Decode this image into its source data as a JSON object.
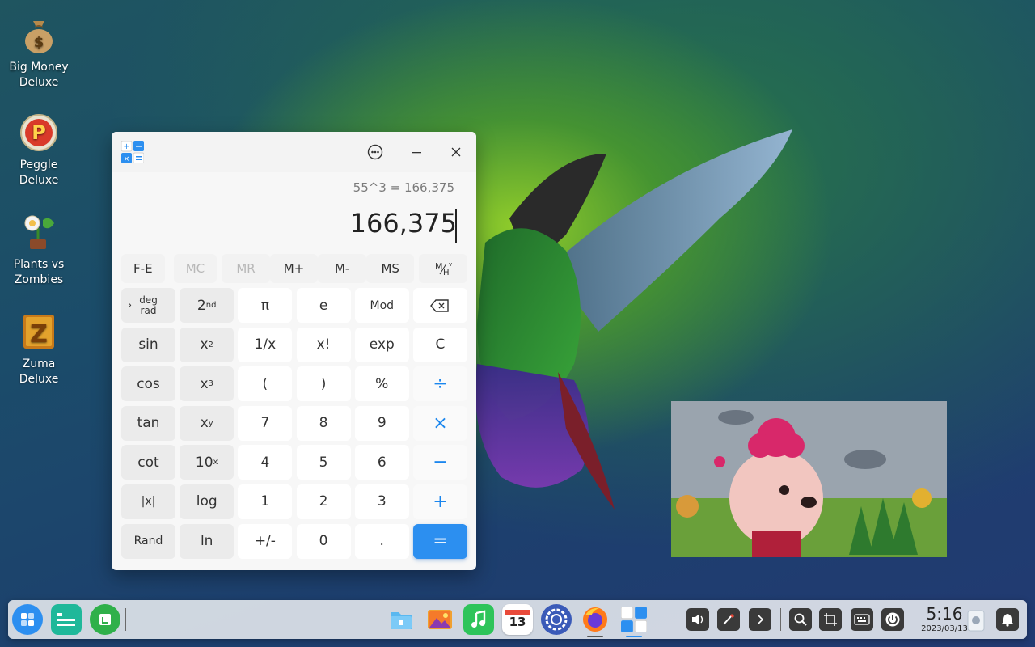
{
  "desktop": {
    "icons": [
      {
        "label": "Big Money\nDeluxe"
      },
      {
        "label": "Peggle\nDeluxe"
      },
      {
        "label": "Plants vs\nZombies"
      },
      {
        "label": "Zuma\nDeluxe"
      }
    ]
  },
  "calculator": {
    "expression": "55^3 = 166,375",
    "result": "166,375",
    "memory": [
      "F-E",
      "MC",
      "MR",
      "M+",
      "M-",
      "MS"
    ],
    "keys": {
      "deg": "deg",
      "rad": "rad",
      "second": "2",
      "second_sup": "nd",
      "pi": "π",
      "e": "e",
      "mod": "Mod",
      "sin": "sin",
      "x2": "x",
      "x2_sup": "2",
      "inv": "1/x",
      "fact": "x!",
      "exp": "exp",
      "clear": "C",
      "cos": "cos",
      "x3": "x",
      "x3_sup": "3",
      "lparen": "(",
      "rparen": ")",
      "percent": "%",
      "divide": "÷",
      "tan": "tan",
      "xy": "x",
      "xy_sup": "y",
      "d7": "7",
      "d8": "8",
      "d9": "9",
      "multiply": "×",
      "cot": "cot",
      "tenx": "10",
      "tenx_sup": "x",
      "d4": "4",
      "d5": "5",
      "d6": "6",
      "minus": "−",
      "abs": "|x|",
      "log": "log",
      "d1": "1",
      "d2": "2",
      "d3": "3",
      "plus": "+",
      "rand": "Rand",
      "ln": "ln",
      "negate": "+/-",
      "d0": "0",
      "dot": ".",
      "equals": "="
    }
  },
  "taskbar": {
    "calendar_day": "13",
    "time": "5:16",
    "date": "2023/03/13"
  },
  "colors": {
    "accent": "#2c8ff0",
    "taskbar": "#e8ecf0"
  }
}
